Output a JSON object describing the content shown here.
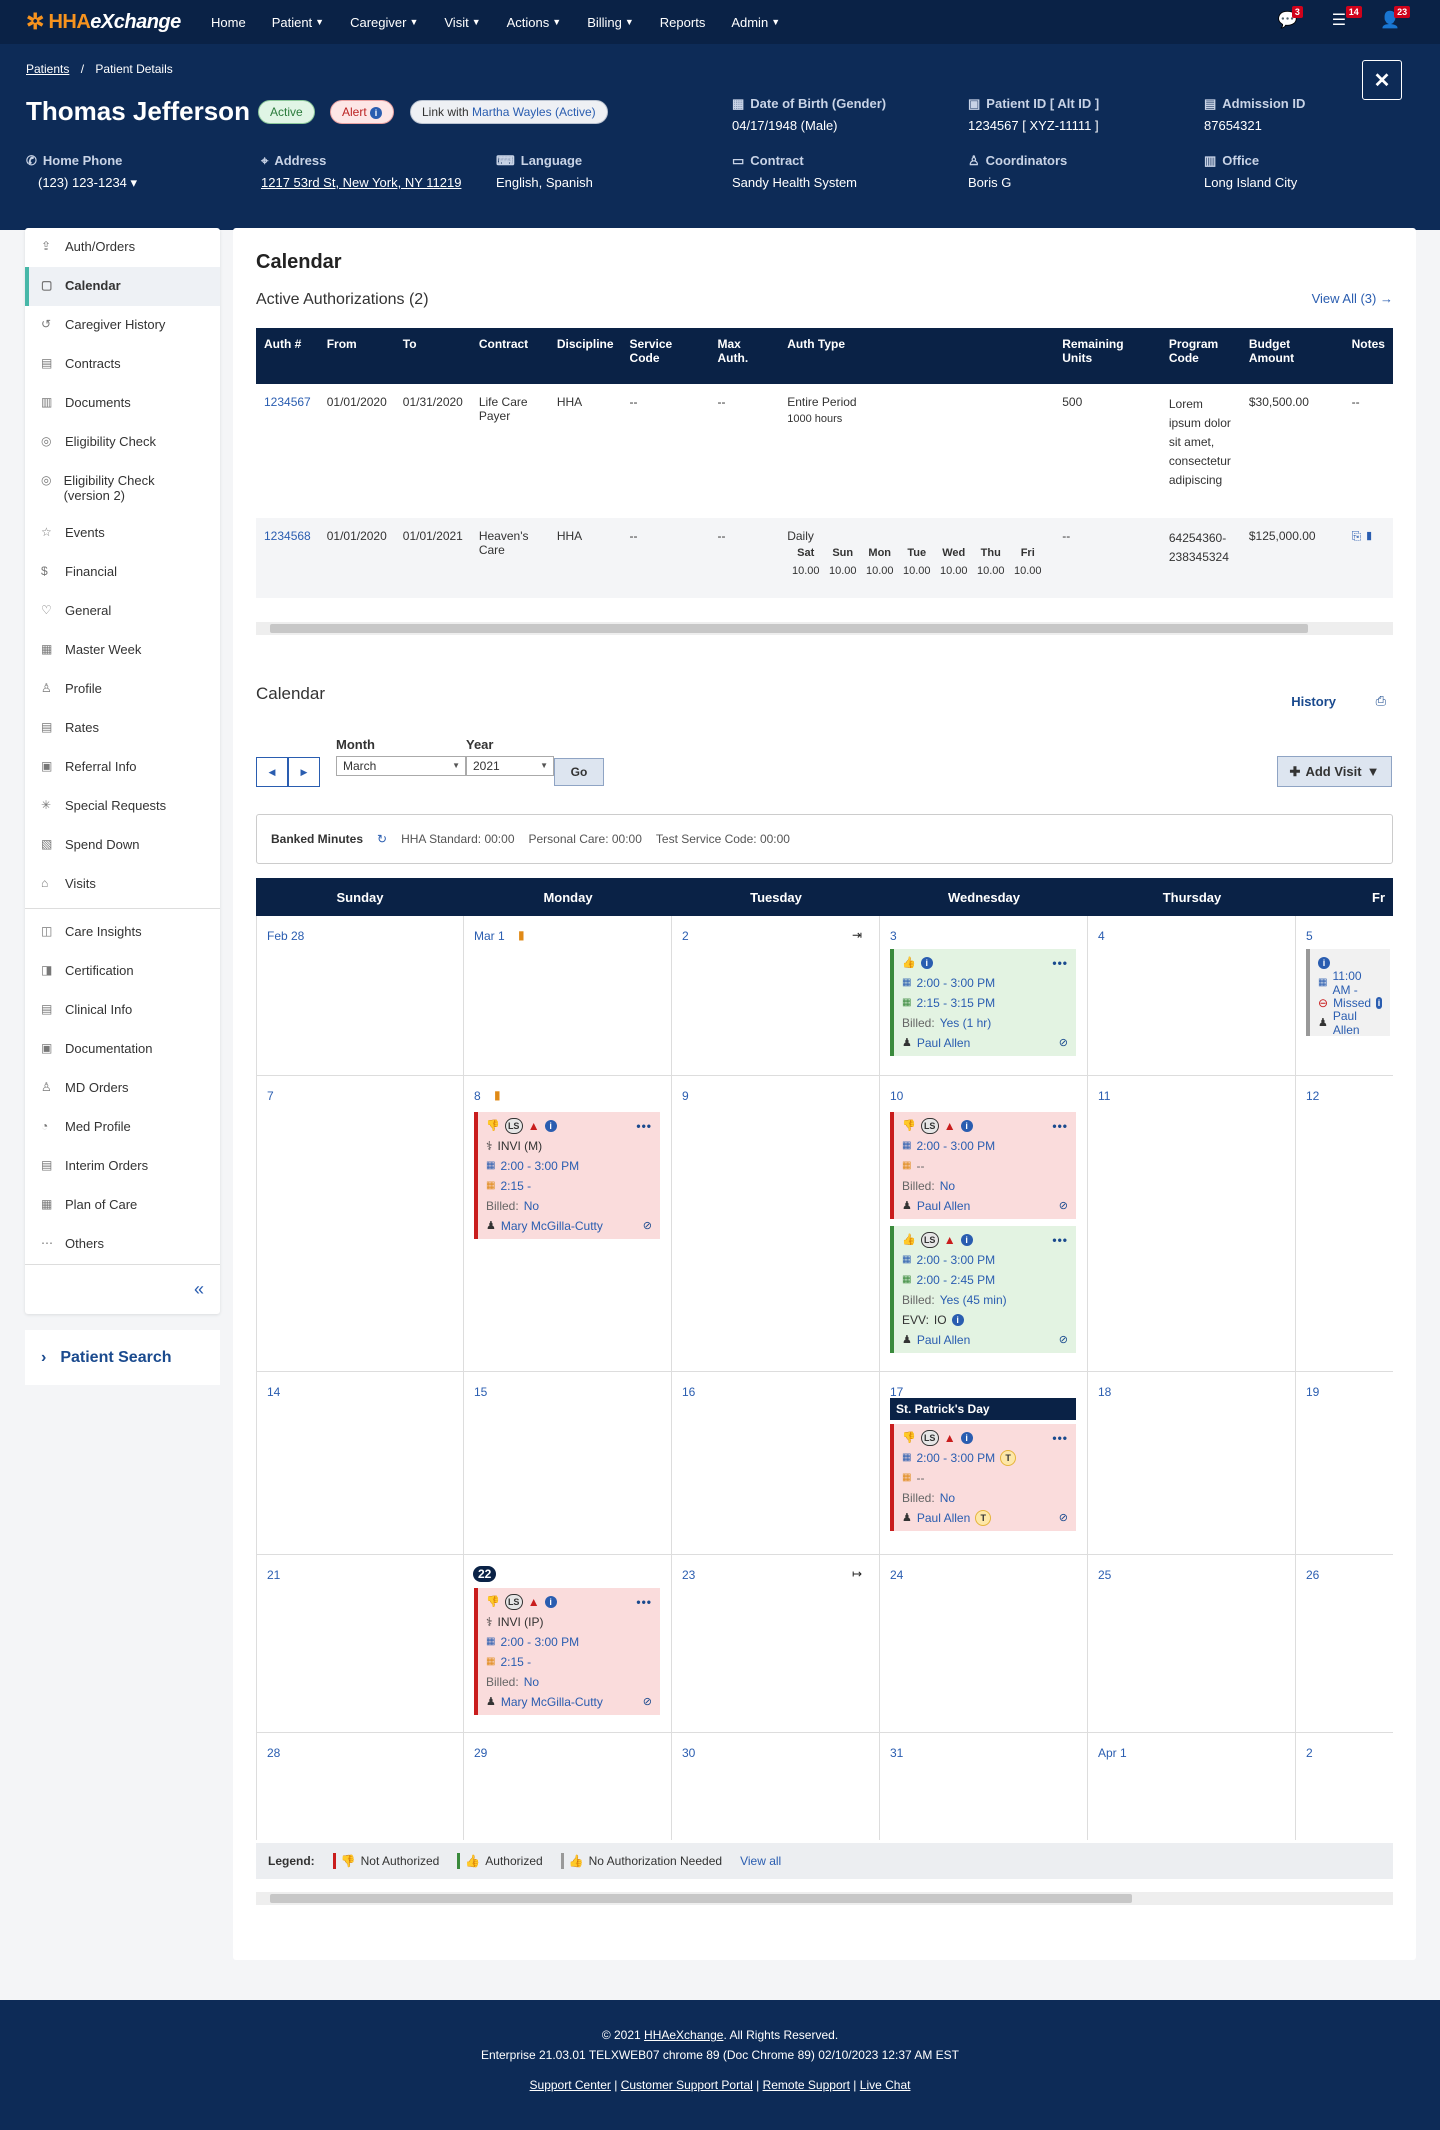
{
  "brand": {
    "logo_hha": "HHA",
    "logo_exchange": "eXchange"
  },
  "nav": {
    "items": [
      "Home",
      "Patient",
      "Caregiver",
      "Visit",
      "Actions",
      "Billing",
      "Reports",
      "Admin"
    ],
    "dropdown": [
      false,
      true,
      true,
      true,
      true,
      true,
      false,
      true
    ],
    "badges": {
      "messages": "3",
      "tasks": "14",
      "user": "23"
    }
  },
  "breadcrumb": {
    "root": "Patients",
    "sep": "/",
    "current": "Patient Details"
  },
  "patient": {
    "name": "Thomas Jefferson",
    "status": "Active",
    "alert": "Alert",
    "link_prefix": "Link with ",
    "link_name": "Martha Wayles (Active)",
    "fields": {
      "dob_label": "Date of Birth (Gender)",
      "dob": "04/17/1948 (Male)",
      "pid_label": "Patient ID [ Alt ID ]",
      "pid": "1234567 [ XYZ-11111 ]",
      "adm_label": "Admission ID",
      "adm": "87654321",
      "phone_label": "Home Phone",
      "phone": "(123) 123-1234",
      "addr_label": "Address",
      "addr": "1217 53rd St, New York, NY 11219",
      "lang_label": "Language",
      "lang": "English, Spanish",
      "contract_label": "Contract",
      "contract": "Sandy Health System",
      "coord_label": "Coordinators",
      "coord": "Boris G",
      "office_label": "Office",
      "office": "Long Island City"
    }
  },
  "sidebar": {
    "group1": [
      "Auth/Orders",
      "Calendar",
      "Caregiver History",
      "Contracts",
      "Documents",
      "Eligibility Check",
      "Eligibility Check (version 2)",
      "Events",
      "Financial",
      "General",
      "Master Week",
      "Profile",
      "Rates",
      "Referral Info",
      "Special Requests",
      "Spend Down",
      "Visits"
    ],
    "group2": [
      "Care Insights",
      "Certification",
      "Clinical Info",
      "Documentation",
      "MD Orders",
      "Med Profile",
      "Interim Orders",
      "Plan of Care",
      "Others"
    ],
    "active": "Calendar",
    "patient_search": "Patient Search"
  },
  "page": {
    "title": "Calendar",
    "auth_heading": "Active Authorizations (2)",
    "view_all": "View All (3)"
  },
  "auth_table": {
    "headers": [
      "Auth #",
      "From",
      "To",
      "Contract",
      "Discipline",
      "Service Code",
      "Max Auth.",
      "Auth Type",
      "Remaining Units",
      "Program Code",
      "Budget Amount",
      "Notes"
    ],
    "rows": [
      {
        "auth": "1234567",
        "from": "01/01/2020",
        "to": "01/31/2020",
        "contract": "Life Care Payer",
        "discipline": "HHA",
        "service": "--",
        "max": "--",
        "type": "Entire Period",
        "type_sub": "1000 hours",
        "remaining": "500",
        "program": "Lorem ipsum dolor sit amet, consectetur adipiscing",
        "budget": "$30,500.00",
        "notes": "--"
      },
      {
        "auth": "1234568",
        "from": "01/01/2020",
        "to": "01/01/2021",
        "contract": "Heaven's Care",
        "discipline": "HHA",
        "service": "--",
        "max": "--",
        "type": "Daily",
        "remaining": "--",
        "program": "64254360-238345324",
        "budget": "$125,000.00",
        "notes": ""
      }
    ],
    "days": [
      "Sat",
      "Sun",
      "Mon",
      "Tue",
      "Wed",
      "Thu",
      "Fri"
    ],
    "day_values": [
      "10.00",
      "10.00",
      "10.00",
      "10.00",
      "10.00",
      "10.00",
      "10.00"
    ]
  },
  "calendar": {
    "title": "Calendar",
    "history": "History",
    "month_label": "Month",
    "month": "March",
    "year_label": "Year",
    "year": "2021",
    "go": "Go",
    "add_visit": "Add Visit",
    "banked_title": "Banked Minutes",
    "banked": [
      "HHA Standard: 00:00",
      "Personal Care: 00:00",
      "Test Service Code: 00:00"
    ],
    "weekdays": [
      "Sunday",
      "Monday",
      "Tuesday",
      "Wednesday",
      "Thursday",
      "Fr"
    ],
    "weeks": [
      [
        "Feb 28",
        "Mar 1",
        "2",
        "3",
        "4",
        "5"
      ],
      [
        "7",
        "8",
        "9",
        "10",
        "11",
        "12"
      ],
      [
        "14",
        "15",
        "16",
        "17",
        "18",
        "19"
      ],
      [
        "21",
        "22",
        "23",
        "24",
        "25",
        "26"
      ],
      [
        "28",
        "29",
        "30",
        "31",
        "Apr 1",
        "2"
      ]
    ],
    "holiday": "St. Patrick's Day",
    "visits": {
      "w0_wed": {
        "sched": "2:00 - 3:00 PM",
        "actual": "2:15 - 3:15 PM",
        "billed_lbl": "Billed:",
        "billed": "Yes (1 hr)",
        "cg": "Paul Allen"
      },
      "w0_fri": {
        "sched": "11:00 AM -",
        "status": "Missed",
        "cg": "Paul Allen"
      },
      "w1_mon": {
        "svc": "INVI (M)",
        "sched": "2:00 - 3:00 PM",
        "actual": "2:15 -",
        "billed_lbl": "Billed:",
        "billed": "No",
        "cg": "Mary McGilla-Cutty"
      },
      "w1_wed_a": {
        "sched": "2:00 - 3:00 PM",
        "actual": "--",
        "billed_lbl": "Billed:",
        "billed": "No",
        "cg": "Paul Allen"
      },
      "w1_wed_b": {
        "sched": "2:00 - 3:00 PM",
        "actual": "2:00 - 2:45 PM",
        "billed_lbl": "Billed:",
        "billed": "Yes (45 min)",
        "evv_lbl": "EVV:",
        "evv": "IO",
        "cg": "Paul Allen"
      },
      "w2_wed": {
        "sched": "2:00 - 3:00 PM",
        "actual": "--",
        "billed_lbl": "Billed:",
        "billed": "No",
        "cg": "Paul Allen",
        "t": "T"
      },
      "w3_mon": {
        "svc": "INVI (IP)",
        "sched": "2:00 - 3:00 PM",
        "actual": "2:15 -",
        "billed_lbl": "Billed:",
        "billed": "No",
        "cg": "Mary McGilla-Cutty"
      }
    },
    "legend": {
      "title": "Legend:",
      "not_auth": "Not Authorized",
      "auth": "Authorized",
      "no_auth": "No Authorization Needed",
      "view_all": "View all"
    }
  },
  "footer": {
    "copyright": "© 2021 ",
    "company": "HHAeXchange",
    "rights": ". All Rights Reserved.",
    "build": "Enterprise 21.03.01 TELXWEB07 chrome 89 (Doc Chrome 89) 02/10/2023 12:37 AM EST",
    "links": [
      "Support Center",
      "Customer Support Portal",
      "Remote Support",
      "Live Chat"
    ]
  },
  "colors": {
    "navy": "#0a2246",
    "accent": "#47b7a8",
    "link": "#2a5db0",
    "notAuth": "#c91d1d",
    "auth": "#3a8a3c",
    "noAuth": "#999999"
  }
}
